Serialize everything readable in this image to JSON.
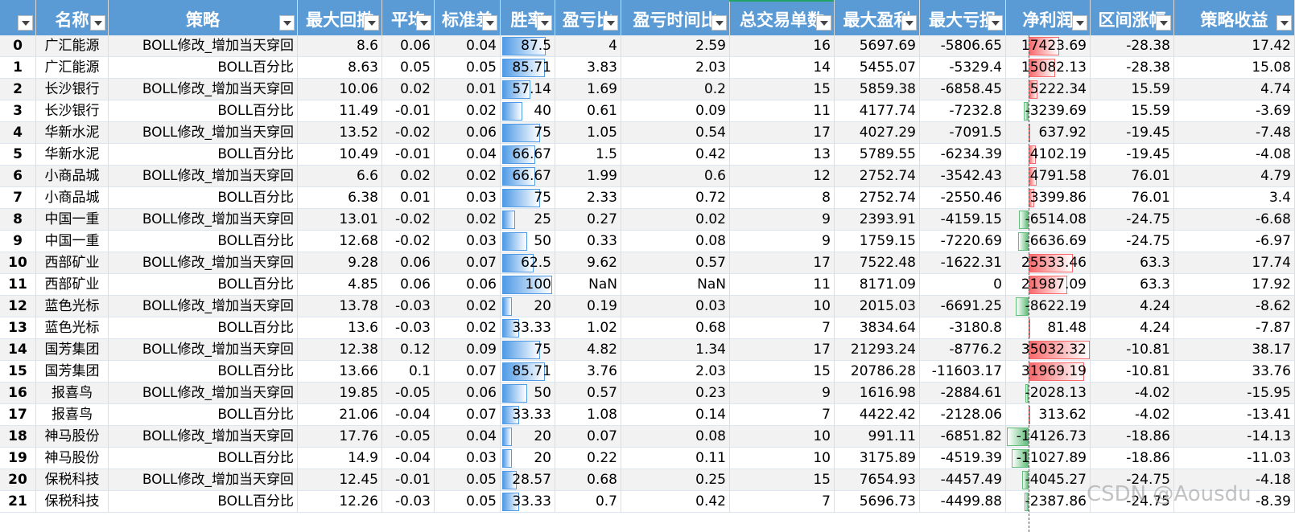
{
  "sheet": {
    "headers": [
      "",
      "名称",
      "策略",
      "最大回撤",
      "平均",
      "标准差",
      "胜率",
      "盈亏比",
      "盈亏时间比",
      "总交易单数",
      "最大盈利",
      "最大亏损",
      "净利润",
      "区间涨幅",
      "策略收益"
    ],
    "rows": [
      [
        "0",
        "广汇能源",
        "BOLL修改_增加当天穿回",
        "8.6",
        "0.06",
        "0.04",
        "87.5",
        "4",
        "2.59",
        "16",
        "5697.69",
        "-5806.65",
        "17423.69",
        "-28.38",
        "17.42"
      ],
      [
        "1",
        "广汇能源",
        "BOLL百分比",
        "8.63",
        "0.05",
        "0.05",
        "85.71",
        "3.83",
        "2.03",
        "14",
        "5455.07",
        "-5329.4",
        "15082.13",
        "-28.38",
        "15.08"
      ],
      [
        "2",
        "长沙银行",
        "BOLL修改_增加当天穿回",
        "10.06",
        "0.02",
        "0.01",
        "57.14",
        "1.69",
        "0.2",
        "15",
        "5859.38",
        "-6858.45",
        "5222.34",
        "15.59",
        "4.74"
      ],
      [
        "3",
        "长沙银行",
        "BOLL百分比",
        "11.49",
        "-0.01",
        "0.02",
        "40",
        "0.61",
        "0.09",
        "11",
        "4177.74",
        "-7232.8",
        "-3239.69",
        "15.59",
        "-3.69"
      ],
      [
        "4",
        "华新水泥",
        "BOLL修改_增加当天穿回",
        "13.52",
        "-0.02",
        "0.06",
        "75",
        "1.05",
        "0.54",
        "17",
        "4027.29",
        "-7091.5",
        "637.92",
        "-19.45",
        "-7.48"
      ],
      [
        "5",
        "华新水泥",
        "BOLL百分比",
        "10.49",
        "-0.01",
        "0.04",
        "66.67",
        "1.5",
        "0.42",
        "13",
        "5789.55",
        "-6234.39",
        "4102.19",
        "-19.45",
        "-4.08"
      ],
      [
        "6",
        "小商品城",
        "BOLL修改_增加当天穿回",
        "6.6",
        "0.02",
        "0.02",
        "66.67",
        "1.99",
        "0.6",
        "12",
        "2752.74",
        "-3542.43",
        "4791.58",
        "76.01",
        "4.79"
      ],
      [
        "7",
        "小商品城",
        "BOLL百分比",
        "6.38",
        "0.01",
        "0.03",
        "75",
        "2.33",
        "0.72",
        "8",
        "2752.74",
        "-2550.46",
        "3399.86",
        "76.01",
        "3.4"
      ],
      [
        "8",
        "中国一重",
        "BOLL修改_增加当天穿回",
        "13.01",
        "-0.02",
        "0.02",
        "25",
        "0.27",
        "0.02",
        "9",
        "2393.91",
        "-4159.15",
        "-6514.08",
        "-24.75",
        "-6.68"
      ],
      [
        "9",
        "中国一重",
        "BOLL百分比",
        "12.68",
        "-0.02",
        "0.03",
        "50",
        "0.33",
        "0.08",
        "9",
        "1759.15",
        "-7220.69",
        "-6636.69",
        "-24.75",
        "-6.97"
      ],
      [
        "10",
        "西部矿业",
        "BOLL修改_增加当天穿回",
        "9.28",
        "0.06",
        "0.07",
        "62.5",
        "9.62",
        "0.57",
        "17",
        "7522.48",
        "-1622.31",
        "25533.46",
        "63.3",
        "17.74"
      ],
      [
        "11",
        "西部矿业",
        "BOLL百分比",
        "4.85",
        "0.06",
        "0.06",
        "100",
        "NaN",
        "NaN",
        "11",
        "8171.09",
        "0",
        "21987.09",
        "63.3",
        "17.92"
      ],
      [
        "12",
        "蓝色光标",
        "BOLL修改_增加当天穿回",
        "13.78",
        "-0.03",
        "0.02",
        "20",
        "0.19",
        "0.03",
        "10",
        "2015.03",
        "-6691.25",
        "-8622.19",
        "4.24",
        "-8.62"
      ],
      [
        "13",
        "蓝色光标",
        "BOLL百分比",
        "13.6",
        "-0.03",
        "0.02",
        "33.33",
        "1.02",
        "0.68",
        "7",
        "3834.64",
        "-3180.8",
        "81.48",
        "4.24",
        "-7.87"
      ],
      [
        "14",
        "国芳集团",
        "BOLL修改_增加当天穿回",
        "12.38",
        "0.12",
        "0.09",
        "75",
        "4.82",
        "1.34",
        "17",
        "21293.24",
        "-8776.2",
        "35032.32",
        "-10.81",
        "38.17"
      ],
      [
        "15",
        "国芳集团",
        "BOLL百分比",
        "13.66",
        "0.1",
        "0.07",
        "85.71",
        "3.76",
        "2.03",
        "15",
        "20786.28",
        "-11603.17",
        "31969.19",
        "-10.81",
        "33.76"
      ],
      [
        "16",
        "报喜鸟",
        "BOLL修改_增加当天穿回",
        "19.85",
        "-0.05",
        "0.06",
        "50",
        "0.57",
        "0.23",
        "9",
        "1616.98",
        "-2884.61",
        "-2028.13",
        "-4.02",
        "-15.95"
      ],
      [
        "17",
        "报喜鸟",
        "BOLL百分比",
        "21.06",
        "-0.04",
        "0.07",
        "33.33",
        "1.08",
        "0.14",
        "7",
        "4422.42",
        "-2128.06",
        "313.62",
        "-4.02",
        "-13.41"
      ],
      [
        "18",
        "神马股份",
        "BOLL修改_增加当天穿回",
        "17.76",
        "-0.05",
        "0.04",
        "20",
        "0.07",
        "0.08",
        "10",
        "991.11",
        "-6851.82",
        "-14126.73",
        "-18.86",
        "-14.13"
      ],
      [
        "19",
        "神马股份",
        "BOLL百分比",
        "14.9",
        "-0.04",
        "0.03",
        "20",
        "0.22",
        "0.11",
        "10",
        "3175.89",
        "-4519.39",
        "-11027.89",
        "-18.86",
        "-11.03"
      ],
      [
        "20",
        "保税科技",
        "BOLL修改_增加当天穿回",
        "12.45",
        "-0.01",
        "0.05",
        "28.57",
        "0.68",
        "0.25",
        "15",
        "7654.93",
        "-4457.49",
        "-4045.27",
        "-24.75",
        "-4.18"
      ],
      [
        "21",
        "保税科技",
        "BOLL百分比",
        "12.26",
        "-0.03",
        "0.05",
        "33.33",
        "0.7",
        "0.42",
        "7",
        "5696.73",
        "-4499.88",
        "-2387.86",
        "-24.75",
        "-8.39"
      ]
    ],
    "filter_icon": "filter-dropdown-icon",
    "colors": {
      "header_bg": "#5b9bd5",
      "winrate_bar": "#4f9be6",
      "profit_bar_positive": "#f8696b",
      "profit_bar_negative": "#63be7b",
      "selected_column_marker": "#21a366"
    },
    "databar_scales": {
      "winrate_max": 100,
      "net_profit_max": 35032.32,
      "net_profit_min": -14126.73
    }
  },
  "watermark": "CSDN @Aousdu"
}
